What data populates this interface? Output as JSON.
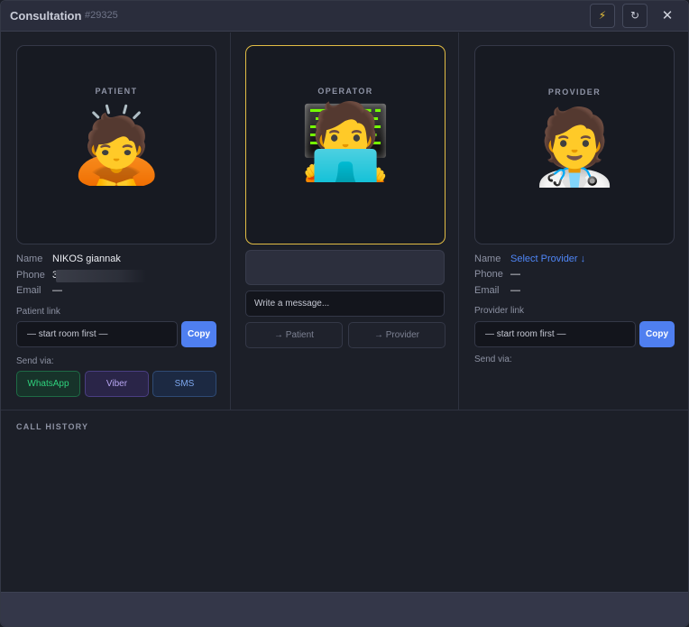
{
  "window": {
    "title": "Consultation",
    "id": "#29325",
    "flash_icon": "⚡",
    "refresh_icon": "↻",
    "close_icon": "✕"
  },
  "patient": {
    "label": "PATIENT",
    "emoji": "🙇",
    "name_key": "Name",
    "name": "NIKOS giannak",
    "phone_key": "Phone",
    "phone": "3(",
    "email_key": "Email",
    "email": "—",
    "link_label": "Patient link",
    "link_value": "— start room first —",
    "copy_label": "Copy",
    "send_via_label": "Send via:",
    "send_buttons": [
      "WhatsApp",
      "Viber",
      "SMS"
    ]
  },
  "operator": {
    "label": "OPERATOR",
    "emoji": "🧑‍💻",
    "message_placeholder": "Write a message...",
    "to_patient_label": "→ Patient",
    "to_provider_label": "→ Provider"
  },
  "provider": {
    "label": "PROVIDER",
    "emoji": "🧑‍⚕️",
    "name_key": "Name",
    "name": "Select Provider ↓",
    "phone_key": "Phone",
    "phone": "—",
    "email_key": "Email",
    "email": "—",
    "link_label": "Provider link",
    "link_value": "— start room first —",
    "copy_label": "Copy",
    "send_via_label": "Send via:"
  },
  "history": {
    "label": "CALL HISTORY"
  },
  "colors": {
    "accent_blue": "#4f7ff0",
    "operator_border": "#e2bd45",
    "whatsapp_green": "#2fd27d",
    "viber_purple": "#b9a7f3",
    "sms_blue": "#7ea8ef"
  }
}
